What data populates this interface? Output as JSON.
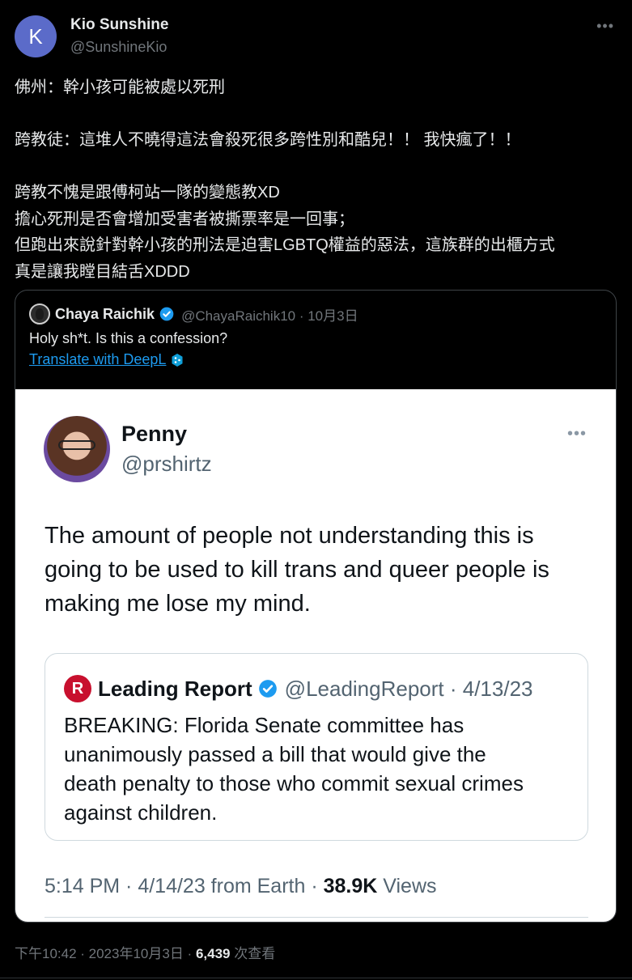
{
  "author": {
    "avatar_letter": "K",
    "display_name": "Kio Sunshine",
    "handle": "@SunshineKio",
    "avatar_color": "#5b6bc9"
  },
  "tweet_lines": [
    "佛州：幹小孩可能被處以死刑",
    "",
    "跨教徒：這堆人不曉得這法會殺死很多跨性別和酷兒！！ 我快瘋了！！",
    "",
    "跨教不愧是跟傅柯站一隊的變態教XD",
    "擔心死刑是否會增加受害者被撕票率是一回事；",
    "但跑出來說針對幹小孩的刑法是迫害LGBTQ權益的惡法，這族群的出櫃方式",
    "真是讓我瞠目結舌XDDD"
  ],
  "quote": {
    "name": "Chaya Raichik",
    "handle_date": "@ChayaRaichik10 · 10月3日",
    "text": "Holy sh*t. Is this a confession?",
    "translate_label": "Translate with DeepL",
    "screenshot": {
      "name": "Penny",
      "handle": "@prshirtz",
      "text_lines": [
        "The amount of people not understanding this is",
        "going to be used to kill trans and queer people is",
        "making me lose my mind."
      ],
      "inner_quote": {
        "logo_letter": "R",
        "name": "Leading Report",
        "handle_date": "@LeadingReport · 4/13/23",
        "text_lines": [
          "BREAKING: Florida Senate committee has",
          "unanimously passed a bill that would give the",
          "death penalty to those who commit sexual crimes",
          "against children."
        ]
      },
      "footer_time": "5:14 PM · 4/14/23 from Earth · ",
      "footer_views_count": "38.9K",
      "footer_views_label": " Views"
    }
  },
  "footer": {
    "time": "下午10:42 · 2023年10月3日 · ",
    "views_count": "6,439",
    "views_label": " 次查看"
  },
  "colors": {
    "background": "#000000",
    "text": "#e7e9ea",
    "muted": "#71767b",
    "link": "#1d9bf0",
    "verified": "#1d9bf0",
    "leading_report_red": "#c8102e"
  }
}
